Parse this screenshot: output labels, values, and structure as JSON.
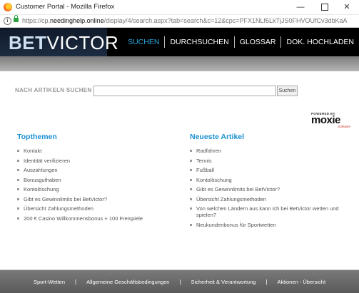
{
  "browser": {
    "window_title": "Customer Portal - Mozilla Firefox",
    "url_prefix": "https://cp.",
    "url_domain": "needinghelp.online",
    "url_rest": "/display/4/search.aspx?tab=search&c=12&cpc=PFX1NLf6LkTjJS0FHVOUfCv3dbKaA",
    "icons": [
      "firefox-icon",
      "info-icon",
      "lock-icon"
    ]
  },
  "header": {
    "logo_bet": "BET",
    "logo_victor": "VICTOR",
    "nav": [
      "SUCHEN",
      "DURCHSUCHEN",
      "GLOSSAR",
      "DOK. HOCHLADEN"
    ],
    "active_nav": "SUCHEN"
  },
  "search": {
    "label": "NACH ARTIKELN SUCHEN",
    "value": "",
    "button": "Suchen"
  },
  "moxie": {
    "powered_by": "POWERED BY",
    "name": "moxie",
    "software": "Software"
  },
  "topthemen": {
    "title": "Topthemen",
    "items": [
      "Kontakt",
      "Identität verifizieren",
      "Auszahlungen",
      "Bonusguthaben",
      "Kontolöschung",
      "Gibt es Gewinnlimits bei BetVictor?",
      "Übersicht Zahlungsmethoden",
      "200 € Casino Willkommensbonus + 100 Freispiele"
    ]
  },
  "neueste": {
    "title": "Neueste Artikel",
    "items": [
      "Radfahren",
      "Tennis",
      "Fußball",
      "Kontolöschung",
      "Gibt es Gewinnlimits bei BetVictor?",
      "Übersicht Zahlungsmethoden",
      "Von welchen Ländern aus kann ich bei BetVictor wetten und spielen?",
      "Neukundenbonus für Sportwetten"
    ]
  },
  "footer": {
    "links": [
      "Sport-Wetten",
      "Allgemeine Geschäftsbedingungen",
      "Sicherheit & Verantwortung",
      "Aktionen - Übersicht"
    ]
  },
  "colors": {
    "accent_blue": "#1a8fd3",
    "header_bg": "#000000",
    "footer_bg": "#6a6a6a"
  }
}
